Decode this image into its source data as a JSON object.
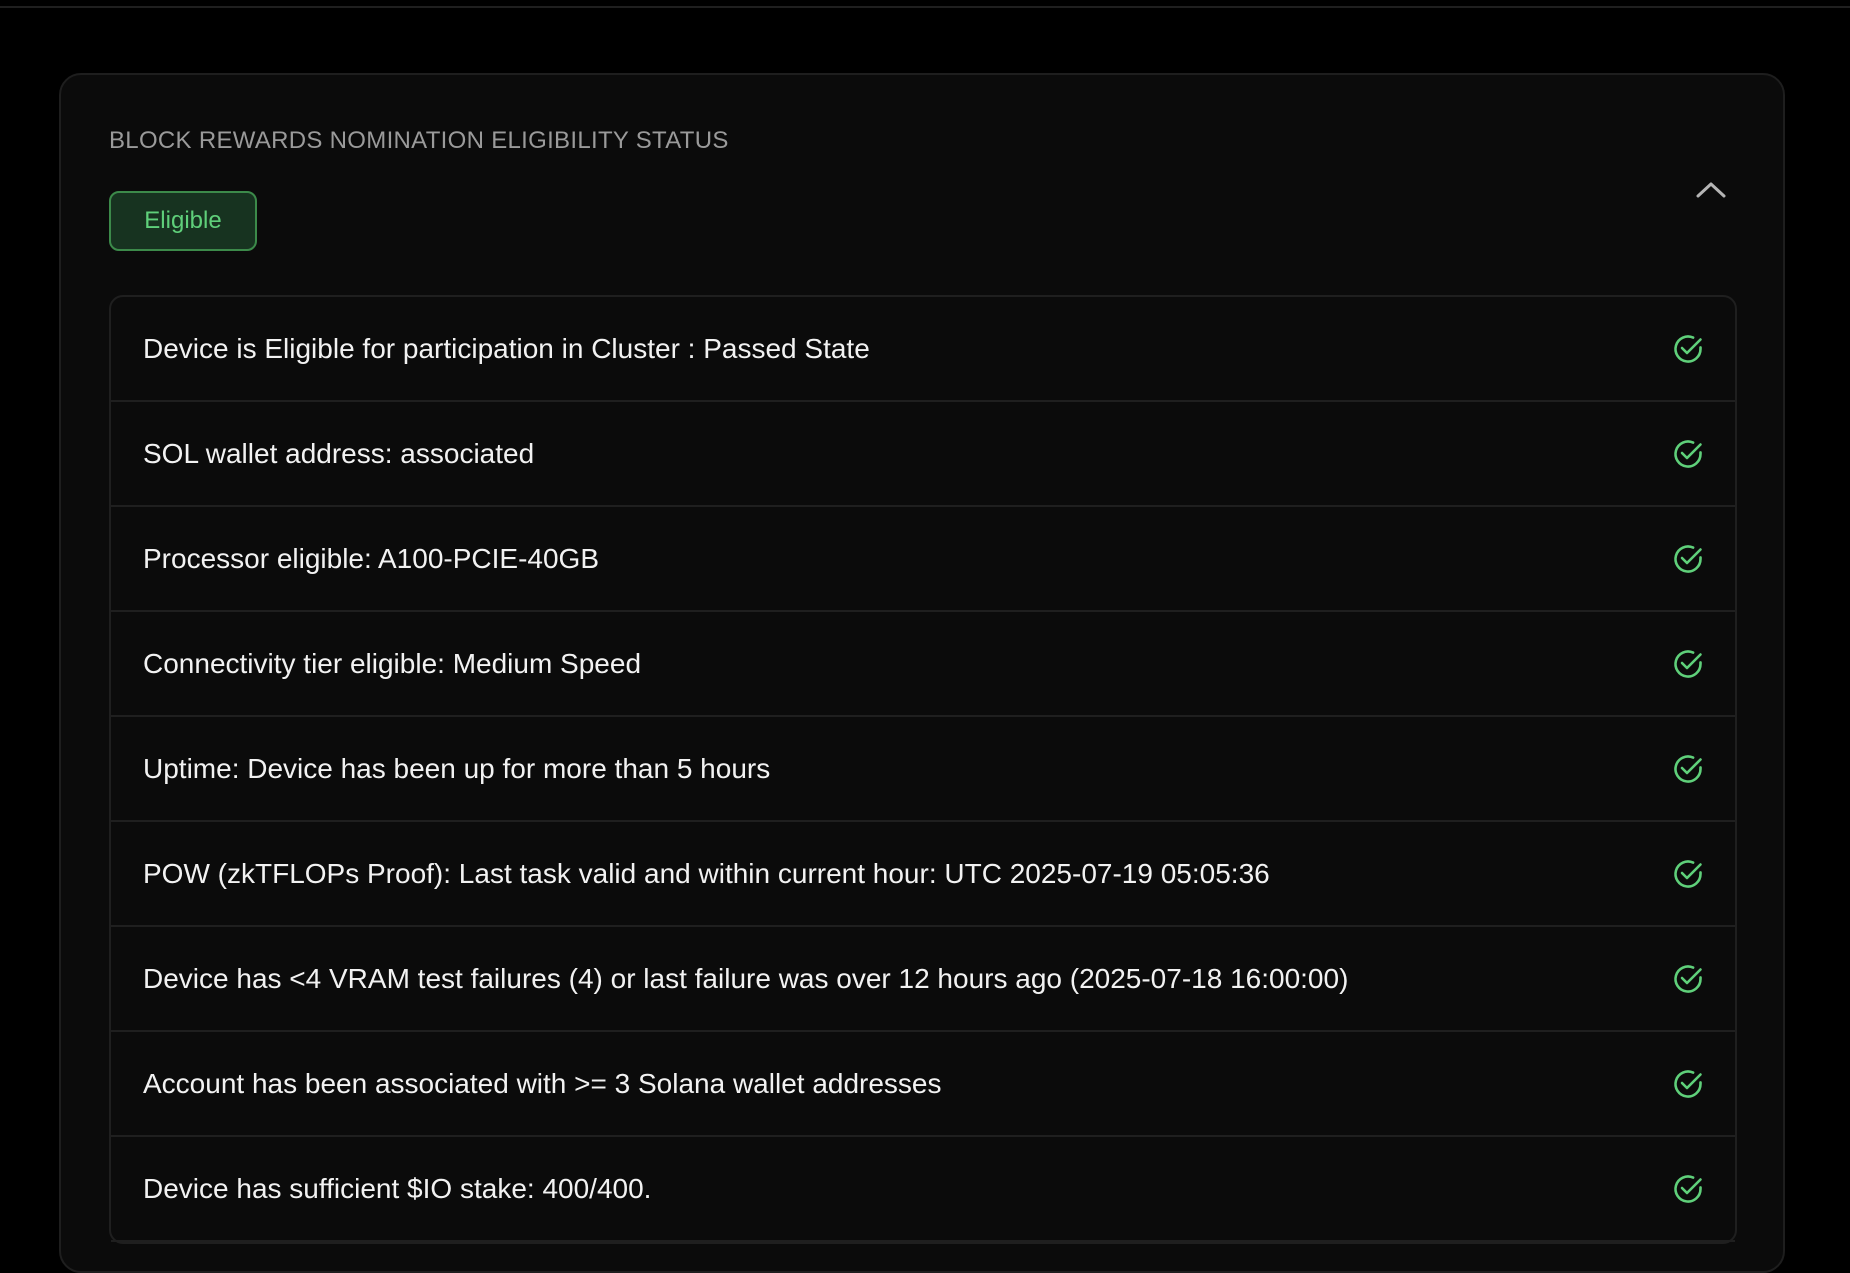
{
  "panel": {
    "title": "BLOCK REWARDS NOMINATION ELIGIBILITY STATUS",
    "status_badge": "Eligible",
    "toggle_icon": "chevron-up-icon"
  },
  "criteria": [
    {
      "text": "Device is Eligible for participation in Cluster : Passed State",
      "status": "passed",
      "icon": "check-circle-icon"
    },
    {
      "text": "SOL wallet address: associated",
      "status": "passed",
      "icon": "check-circle-icon"
    },
    {
      "text": "Processor eligible: A100-PCIE-40GB",
      "status": "passed",
      "icon": "check-circle-icon"
    },
    {
      "text": "Connectivity tier eligible: Medium Speed",
      "status": "passed",
      "icon": "check-circle-icon"
    },
    {
      "text": "Uptime: Device has been up for more than 5 hours",
      "status": "passed",
      "icon": "check-circle-icon"
    },
    {
      "text": "POW (zkTFLOPs Proof): Last task valid and within current hour: UTC 2025-07-19 05:05:36",
      "status": "passed",
      "icon": "check-circle-icon"
    },
    {
      "text": "Device has <4 VRAM test failures (4) or last failure was over 12 hours ago (2025-07-18 16:00:00)",
      "status": "passed",
      "icon": "check-circle-icon"
    },
    {
      "text": "Account has been associated with >= 3 Solana wallet addresses",
      "status": "passed",
      "icon": "check-circle-icon"
    },
    {
      "text": "Device has sufficient $IO stake: 400/400.",
      "status": "passed",
      "icon": "check-circle-icon"
    }
  ],
  "colors": {
    "background": "#000000",
    "card": "#0b0b0b",
    "border": "#1f1f1f",
    "success": "#5fd07a",
    "badge_bg": "#173320",
    "title_text": "#9a9a9a",
    "row_text": "#f2f2f2"
  }
}
